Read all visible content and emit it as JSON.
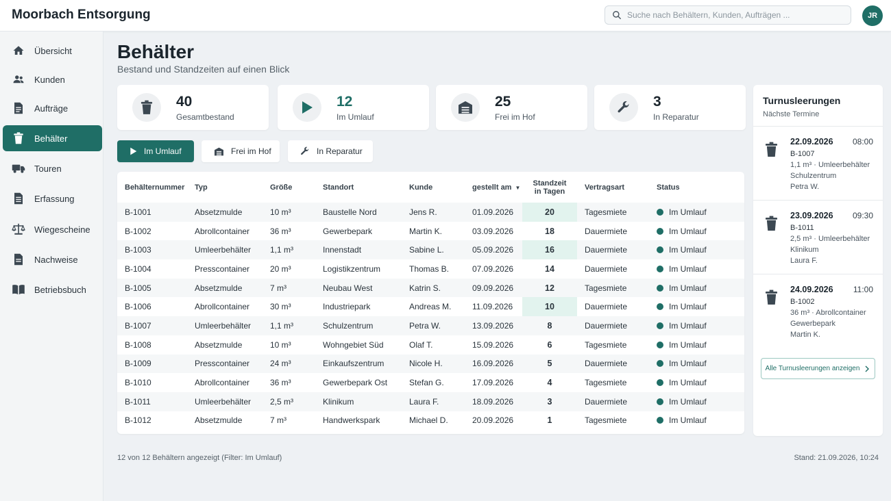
{
  "header": {
    "brand": "Moorbach Entsorgung",
    "search_placeholder": "Suche nach Behältern, Kunden, Aufträgen ...",
    "avatar_initials": "JR"
  },
  "sidebar": {
    "items": [
      {
        "label": "Übersicht",
        "icon": "home-icon"
      },
      {
        "label": "Kunden",
        "icon": "users-icon"
      },
      {
        "label": "Aufträge",
        "icon": "document-icon"
      },
      {
        "label": "Behälter",
        "icon": "trash-bin-icon",
        "active": true
      },
      {
        "label": "Touren",
        "icon": "truck-icon"
      },
      {
        "label": "Erfassung",
        "icon": "clipboard-icon"
      },
      {
        "label": "Wiegescheine",
        "icon": "scale-icon"
      },
      {
        "label": "Nachweise",
        "icon": "document-icon"
      },
      {
        "label": "Betriebsbuch",
        "icon": "book-icon"
      }
    ]
  },
  "page": {
    "title": "Behälter",
    "subtitle": "Bestand und Standzeiten auf einen Blick"
  },
  "stats": [
    {
      "value": "40",
      "label": "Gesamtbestand",
      "icon": "trash-bin-icon"
    },
    {
      "value": "12",
      "label": "Im Umlauf",
      "icon": "play-icon"
    },
    {
      "value": "25",
      "label": "Frei im Hof",
      "icon": "garage-icon"
    },
    {
      "value": "3",
      "label": "In Reparatur",
      "icon": "wrench-icon"
    }
  ],
  "filters": [
    {
      "label": "Im Umlauf",
      "icon": "play-icon",
      "active": true
    },
    {
      "label": "Frei im Hof",
      "icon": "garage-icon"
    },
    {
      "label": "In Reparatur",
      "icon": "wrench-icon"
    }
  ],
  "table": {
    "headers": {
      "id": "Behälternummer",
      "type": "Typ",
      "size": "Größe",
      "location": "Standort",
      "customer": "Kunde",
      "date": "gestellt am",
      "days_line1": "Standzeit",
      "days_line2": "in Tagen",
      "contract": "Vertragsart",
      "status": "Status"
    },
    "rows": [
      {
        "id": "B-1001",
        "type": "Absetzmulde",
        "size": "10 m³",
        "location": "Baustelle Nord",
        "customer": "Jens R.",
        "date": "01.09.2026",
        "days": "20",
        "contract": "Tagesmiete",
        "status": "Im Umlauf"
      },
      {
        "id": "B-1002",
        "type": "Abrollcontainer",
        "size": "36 m³",
        "location": "Gewerbepark",
        "customer": "Martin K.",
        "date": "03.09.2026",
        "days": "18",
        "contract": "Dauermiete",
        "status": "Im Umlauf"
      },
      {
        "id": "B-1003",
        "type": "Umleerbehälter",
        "size": "1,1 m³",
        "location": "Innenstadt",
        "customer": "Sabine L.",
        "date": "05.09.2026",
        "days": "16",
        "contract": "Dauermiete",
        "status": "Im Umlauf"
      },
      {
        "id": "B-1004",
        "type": "Presscontainer",
        "size": "20 m³",
        "location": "Logistikzentrum",
        "customer": "Thomas B.",
        "date": "07.09.2026",
        "days": "14",
        "contract": "Dauermiete",
        "status": "Im Umlauf"
      },
      {
        "id": "B-1005",
        "type": "Absetzmulde",
        "size": "7 m³",
        "location": "Neubau West",
        "customer": "Katrin S.",
        "date": "09.09.2026",
        "days": "12",
        "contract": "Tagesmiete",
        "status": "Im Umlauf"
      },
      {
        "id": "B-1006",
        "type": "Abrollcontainer",
        "size": "30 m³",
        "location": "Industriepark",
        "customer": "Andreas M.",
        "date": "11.09.2026",
        "days": "10",
        "contract": "Dauermiete",
        "status": "Im Umlauf"
      },
      {
        "id": "B-1007",
        "type": "Umleerbehälter",
        "size": "1,1 m³",
        "location": "Schulzentrum",
        "customer": "Petra W.",
        "date": "13.09.2026",
        "days": "8",
        "contract": "Dauermiete",
        "status": "Im Umlauf"
      },
      {
        "id": "B-1008",
        "type": "Absetzmulde",
        "size": "10 m³",
        "location": "Wohngebiet Süd",
        "customer": "Olaf T.",
        "date": "15.09.2026",
        "days": "6",
        "contract": "Tagesmiete",
        "status": "Im Umlauf"
      },
      {
        "id": "B-1009",
        "type": "Presscontainer",
        "size": "24 m³",
        "location": "Einkaufszentrum",
        "customer": "Nicole H.",
        "date": "16.09.2026",
        "days": "5",
        "contract": "Dauermiete",
        "status": "Im Umlauf"
      },
      {
        "id": "B-1010",
        "type": "Abrollcontainer",
        "size": "36 m³",
        "location": "Gewerbepark Ost",
        "customer": "Stefan G.",
        "date": "17.09.2026",
        "days": "4",
        "contract": "Tagesmiete",
        "status": "Im Umlauf"
      },
      {
        "id": "B-1011",
        "type": "Umleerbehälter",
        "size": "2,5 m³",
        "location": "Klinikum",
        "customer": "Laura F.",
        "date": "18.09.2026",
        "days": "3",
        "contract": "Dauermiete",
        "status": "Im Umlauf"
      },
      {
        "id": "B-1012",
        "type": "Absetzmulde",
        "size": "7 m³",
        "location": "Handwerkspark",
        "customer": "Michael D.",
        "date": "20.09.2026",
        "days": "1",
        "contract": "Tagesmiete",
        "status": "Im Umlauf"
      }
    ]
  },
  "appointments": {
    "title": "Turnusleerungen",
    "subtitle": "Nächste Termine",
    "items": [
      {
        "date": "22.09.2026",
        "time": "08:00",
        "id": "B-1007",
        "detail": "1,1 m³ · Umleerbehälter",
        "location": "Schulzentrum",
        "person": "Petra W."
      },
      {
        "date": "23.09.2026",
        "time": "09:30",
        "id": "B-1011",
        "detail": "2,5 m³ · Umleerbehälter",
        "location": "Klinikum",
        "person": "Laura F."
      },
      {
        "date": "24.09.2026",
        "time": "11:00",
        "id": "B-1002",
        "detail": "36 m³ · Abrollcontainer",
        "location": "Gewerbepark",
        "person": "Martin K."
      }
    ],
    "all_label": "Alle Turnusleerungen anzeigen"
  },
  "footer": {
    "count_text": "12 von 12 Behältern angezeigt (Filter: Im Umlauf)",
    "timestamp": "Stand: 21.09.2026, 10:24"
  },
  "colors": {
    "accent": "#1f6e66",
    "highlight": "#e2f3ee"
  }
}
